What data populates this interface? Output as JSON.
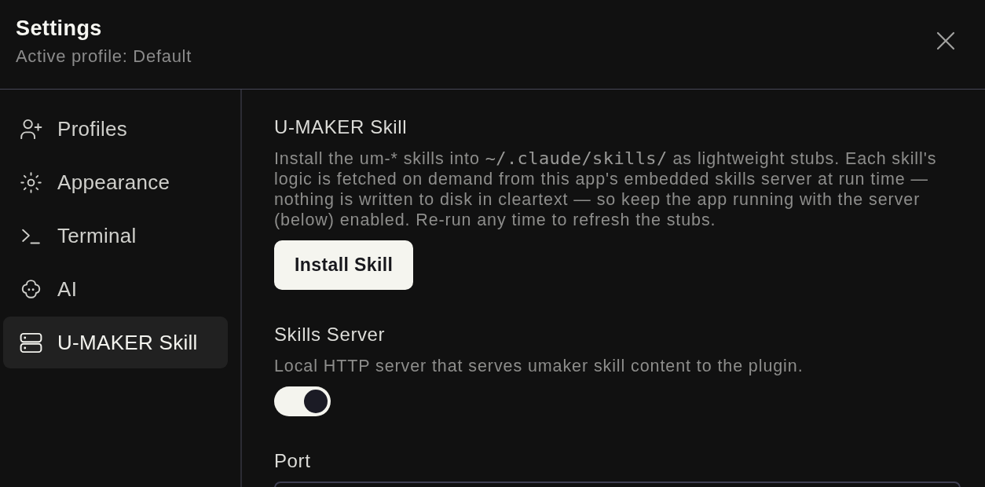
{
  "window": {
    "title": "Settings",
    "subtitle": "Active profile: Default"
  },
  "sidebar": {
    "items": [
      {
        "label": "Profiles",
        "selected": false
      },
      {
        "label": "Appearance",
        "selected": false
      },
      {
        "label": "Terminal",
        "selected": false
      },
      {
        "label": "AI",
        "selected": false
      },
      {
        "label": "U-MAKER Skill",
        "selected": true
      }
    ]
  },
  "sections": [
    {
      "kind": "action",
      "heading": "U-MAKER Skill",
      "description": [
        {
          "kind": "text",
          "text": "Install the um-* skills into "
        },
        {
          "kind": "code",
          "text": "~/.claude/skills/"
        },
        {
          "kind": "text",
          "text": " as lightweight stubs. Each skill's logic is fetched on demand from this app's embedded skills server at run time — nothing is written to disk in cleartext — so keep the app running with the server (below) enabled. Re-run any time to refresh the stubs."
        }
      ],
      "button": "Install Skill"
    },
    {
      "kind": "toggle",
      "heading": "Skills Server",
      "description": [
        {
          "kind": "text",
          "text": "Local HTTP server that serves umaker skill content to the plugin."
        }
      ],
      "on": true
    },
    {
      "kind": "field",
      "heading": "Port"
    }
  ]
}
